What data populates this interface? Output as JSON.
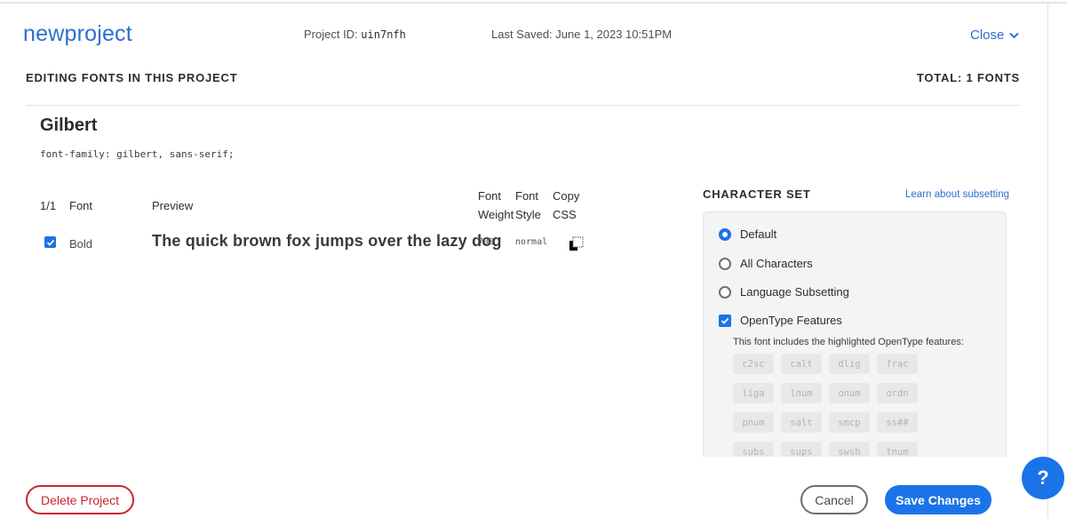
{
  "header": {
    "project_name": "newproject",
    "project_id_label": "Project ID: ",
    "project_id": "uin7nfh",
    "last_saved": "Last Saved: June 1, 2023 10:51PM",
    "close_label": "Close"
  },
  "section": {
    "title": "EDITING FONTS IN THIS PROJECT",
    "total": "TOTAL: 1 FONTS"
  },
  "font": {
    "name": "Gilbert",
    "css": "font-family: gilbert, sans-serif;"
  },
  "table": {
    "headers": {
      "count": "1/1",
      "font": "Font",
      "preview": "Preview",
      "weight_line1": "Font",
      "weight_line2": "Weight",
      "style_line1": "Font",
      "style_line2": "Style",
      "copy_line1": "Copy",
      "copy_line2": "CSS"
    },
    "rows": [
      {
        "checked": true,
        "font": "Bold",
        "preview": "The quick brown fox jumps over the lazy dog",
        "weight": "700",
        "style": "normal"
      }
    ]
  },
  "charset": {
    "title": "CHARACTER SET",
    "learn_link": "Learn about subsetting",
    "options": [
      {
        "label": "Default",
        "selected": true
      },
      {
        "label": "All Characters",
        "selected": false
      },
      {
        "label": "Language Subsetting",
        "selected": false
      }
    ],
    "opentype": {
      "label": "OpenType Features",
      "checked": true,
      "hint": "This font includes the highlighted OpenType features:",
      "features": [
        "c2sc",
        "calt",
        "dlig",
        "frac",
        "liga",
        "lnum",
        "onum",
        "ordn",
        "pnum",
        "salt",
        "smcp",
        "ss##",
        "subs",
        "sups",
        "swsh",
        "tnum"
      ]
    }
  },
  "footer": {
    "delete_label": "Delete Project",
    "cancel_label": "Cancel",
    "save_label": "Save Changes",
    "help_label": "?"
  },
  "colors": {
    "accent": "#1a73e8",
    "link": "#2d6fd1",
    "danger": "#c9252d"
  }
}
